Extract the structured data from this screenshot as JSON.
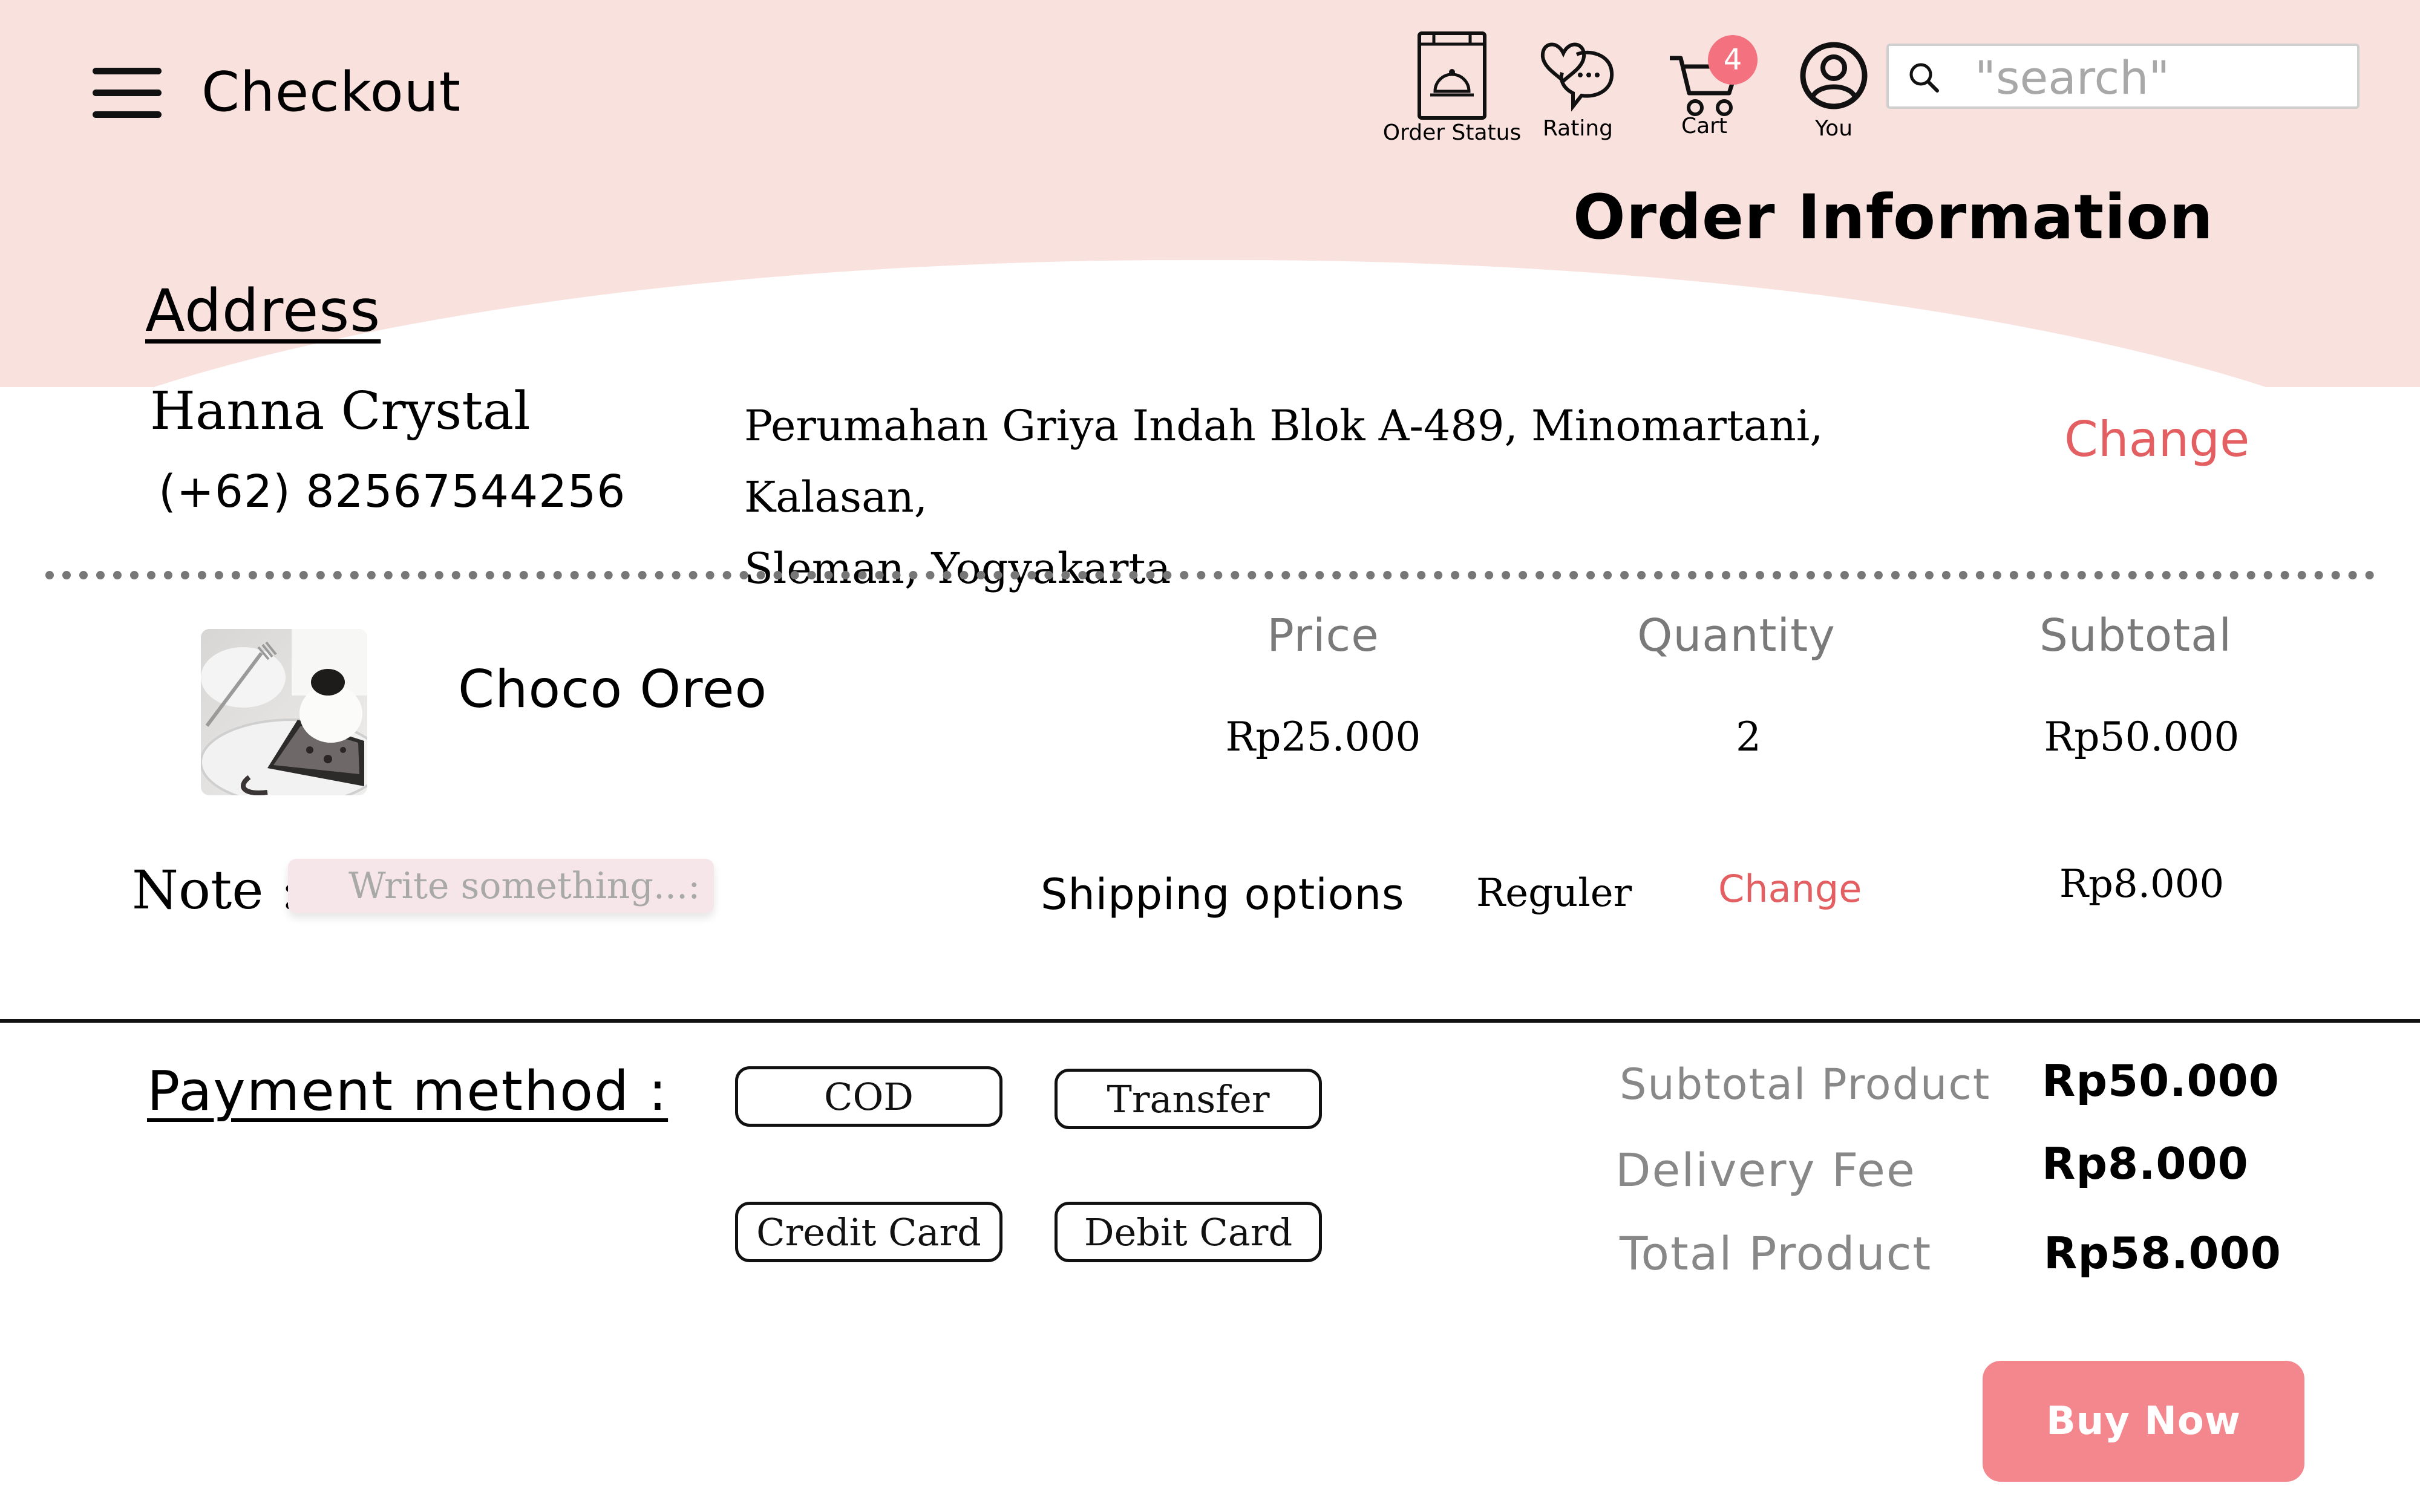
{
  "header": {
    "title": "Checkout",
    "nav": [
      {
        "label": "Order Status",
        "icon": "order-bag-icon"
      },
      {
        "label": "Rating",
        "icon": "heart-chat-icon"
      },
      {
        "label": "Cart",
        "icon": "cart-icon"
      },
      {
        "label": "You",
        "icon": "user-icon"
      }
    ],
    "cart_count": "4",
    "search_placeholder": "\"search\""
  },
  "section_title": "Order Information",
  "address": {
    "title": "Address",
    "name": "Hanna Crystal",
    "phone": "(+62) 82567544256",
    "line1": "Perumahan Griya Indah Blok A-489, Minomartani, Kalasan,",
    "line2": "Sleman, Yogyakarta",
    "change_label": "Change"
  },
  "product": {
    "name": "Choco Oreo",
    "columns": {
      "price": "Price",
      "quantity": "Quantity",
      "subtotal": "Subtotal"
    },
    "price": "Rp25.000",
    "quantity": "2",
    "subtotal": "Rp50.000"
  },
  "note": {
    "label": "Note :",
    "placeholder": "Write something...:"
  },
  "shipping": {
    "label": "Shipping options",
    "type": "Reguler",
    "change_label": "Change",
    "price": "Rp8.000"
  },
  "payment": {
    "title": "Payment method :",
    "options": [
      "COD",
      "Transfer",
      "Credit Card",
      "Debit Card"
    ]
  },
  "summary": {
    "subtotal_label": "Subtotal Product",
    "subtotal_value": "Rp50.000",
    "delivery_label": "Delivery Fee",
    "delivery_value": "Rp8.000",
    "total_label": "Total Product",
    "total_value": "Rp58.000"
  },
  "buy_label": "Buy Now",
  "colors": {
    "header_bg": "#F9E1DE",
    "accent_red": "#E45F62",
    "buy_button": "#F4878E",
    "badge": "#F4727F"
  }
}
